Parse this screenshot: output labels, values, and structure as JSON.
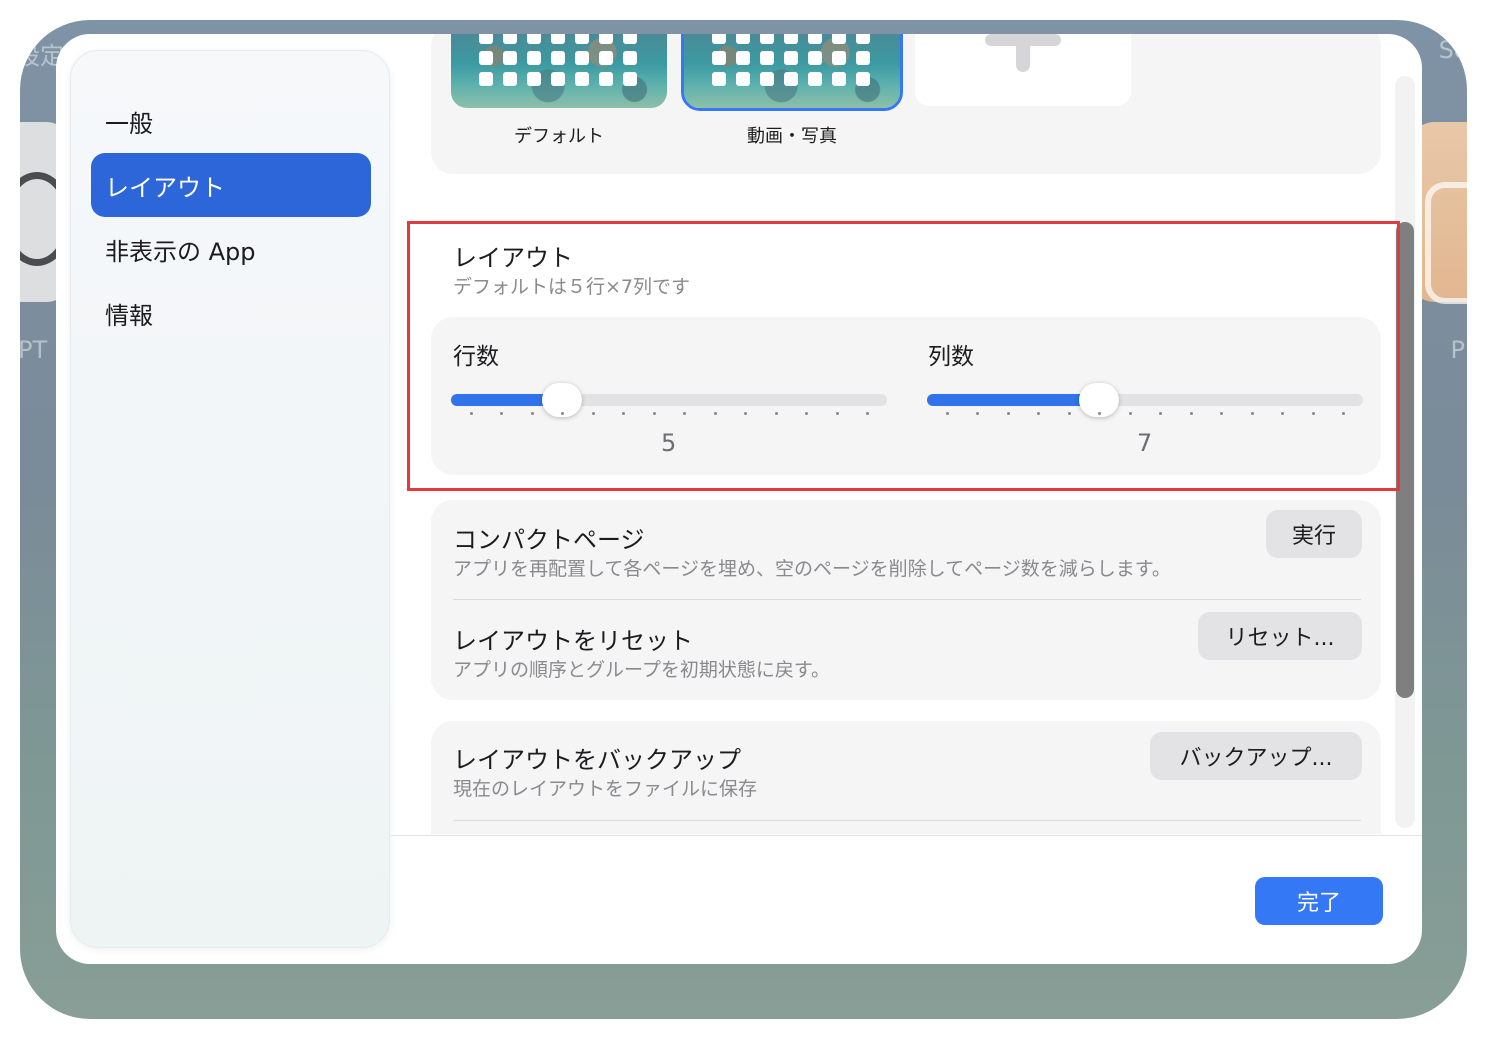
{
  "background": {
    "left_label": "設定",
    "left_app_label": "PT",
    "right_label": "Sc",
    "right_app_label": "P"
  },
  "sidebar": {
    "items": [
      {
        "label": "一般",
        "active": false
      },
      {
        "label": "レイアウト",
        "active": true
      },
      {
        "label": "非表示の App",
        "active": false
      },
      {
        "label": "情報",
        "active": false
      }
    ]
  },
  "presets": {
    "items": [
      {
        "label": "デフォルト",
        "selected": false
      },
      {
        "label": "動画・写真",
        "selected": true
      }
    ],
    "add_icon": "plus-icon"
  },
  "layout_section": {
    "title": "レイアウト",
    "subtitle": "デフォルトは５行×7列です",
    "rows": {
      "label": "行数",
      "value": "5",
      "min": 2,
      "max": 15,
      "current": 5
    },
    "columns": {
      "label": "列数",
      "value": "7",
      "min": 2,
      "max": 15,
      "current": 7
    }
  },
  "actions": {
    "compact": {
      "title": "コンパクトページ",
      "subtitle": "アプリを再配置して各ページを埋め、空のページを削除してページ数を減らします。",
      "button": "実行"
    },
    "reset": {
      "title": "レイアウトをリセット",
      "subtitle": "アプリの順序とグループを初期状態に戻す。",
      "button": "リセット..."
    },
    "backup": {
      "title": "レイアウトをバックアップ",
      "subtitle": "現在のレイアウトをファイルに保存",
      "button": "バックアップ..."
    }
  },
  "footer": {
    "done_label": "完了"
  },
  "colors": {
    "accent": "#3478f6",
    "sidebar_active": "#2d66d8",
    "highlight": "#e0393f"
  }
}
